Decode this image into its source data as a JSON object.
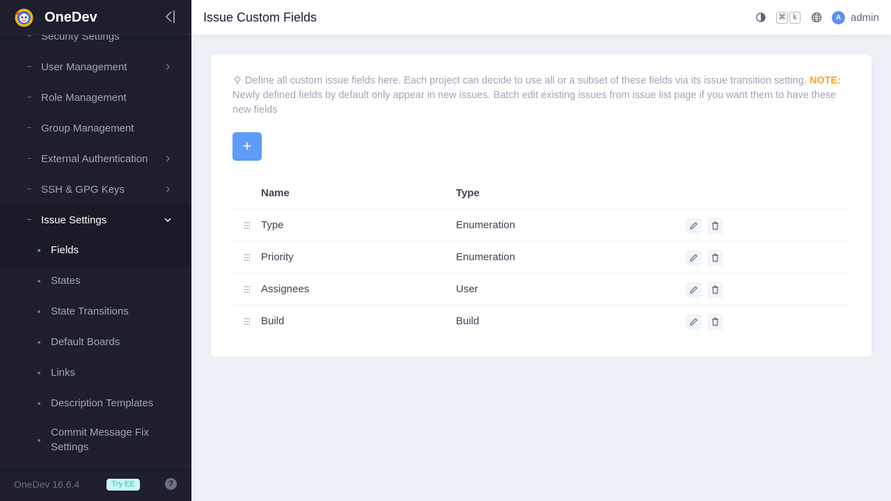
{
  "app": {
    "name": "OneDev",
    "version": "OneDev 16.6.4",
    "try_ee": "Try EE",
    "help": "?"
  },
  "sidebar": {
    "items": [
      {
        "label": "Security Settings",
        "chevron": false
      },
      {
        "label": "User Management",
        "chevron": true
      },
      {
        "label": "Role Management",
        "chevron": false
      },
      {
        "label": "Group Management",
        "chevron": false
      },
      {
        "label": "External Authentication",
        "chevron": true
      },
      {
        "label": "SSH & GPG Keys",
        "chevron": true
      },
      {
        "label": "Issue Settings",
        "chevron": true,
        "expanded": true
      }
    ],
    "sub_items": [
      {
        "label": "Fields",
        "active": true
      },
      {
        "label": "States"
      },
      {
        "label": "State Transitions"
      },
      {
        "label": "Default Boards"
      },
      {
        "label": "Links"
      },
      {
        "label": "Description Templates"
      },
      {
        "label": "Commit Message Fix Settings"
      }
    ]
  },
  "header": {
    "title": "Issue Custom Fields",
    "shortcut_cmd": "⌘",
    "shortcut_key": "k",
    "avatar_initial": "A",
    "username": "admin"
  },
  "main": {
    "tip_text": "Define all custom issue fields here. Each project can decide to use all or a subset of these fields via its issue transition setting.",
    "tip_note": "NOTE:",
    "tip_rest": "Newly defined fields by default only appear in new issues. Batch edit existing issues from issue list page if you want them to have these new fields",
    "add_label": "+",
    "columns": [
      "Name",
      "Type"
    ],
    "rows": [
      {
        "name": "Type",
        "type": "Enumeration"
      },
      {
        "name": "Priority",
        "type": "Enumeration"
      },
      {
        "name": "Assignees",
        "type": "User"
      },
      {
        "name": "Build",
        "type": "Build"
      }
    ]
  },
  "colors": {
    "accent": "#5e9cf7",
    "sidebar_bg": "#1e1e2d",
    "note": "#f5a623"
  }
}
